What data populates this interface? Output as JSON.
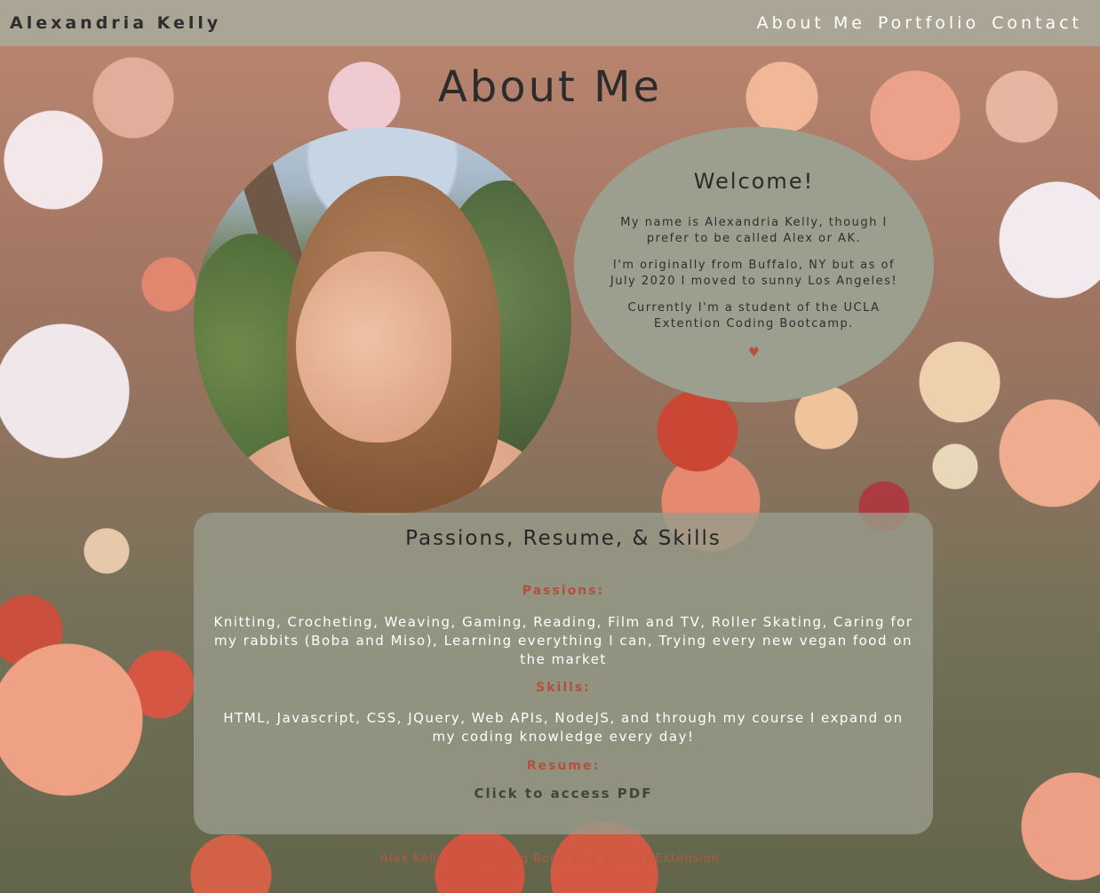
{
  "navbar": {
    "brand": "Alexandria Kelly",
    "links": [
      "About Me",
      "Portfolio",
      "Contact"
    ]
  },
  "page": {
    "title": "About Me"
  },
  "profile": {
    "photo_alt": "Portrait of Alexandria Kelly"
  },
  "welcome": {
    "heading": "Welcome!",
    "paragraphs": [
      "My name is Alexandria Kelly, though I prefer to be called Alex or AK.",
      "I'm originally from Buffalo, NY but as of July 2020 I moved to sunny Los Angeles!",
      "Currently I'm a student of the UCLA Extention Coding Bootcamp."
    ],
    "heart": "♥"
  },
  "panel": {
    "heading": "Passions, Resume, & Skills",
    "passions_label": "Passions:",
    "passions_text": "Knitting, Crocheting, Weaving, Gaming, Reading, Film and TV, Roller Skating, Caring for my rabbits (Boba and Miso), Learning everything I can, Trying every new vegan food on the market",
    "skills_label": "Skills:",
    "skills_text": "HTML, Javascript, CSS, JQuery, Web APIs, NodeJS, and through my course I expand on my coding knowledge every day!",
    "resume_label": "Resume:",
    "resume_link": "Click to access PDF"
  },
  "footer": {
    "text": "Alex Kelly, The Coding Bootcamp @ UCLAExtension"
  },
  "colors": {
    "navbar_bg": "#a8a898",
    "accent": "#b4503f",
    "card_bg": "#9c9f8e",
    "link": "#3c4a33"
  }
}
